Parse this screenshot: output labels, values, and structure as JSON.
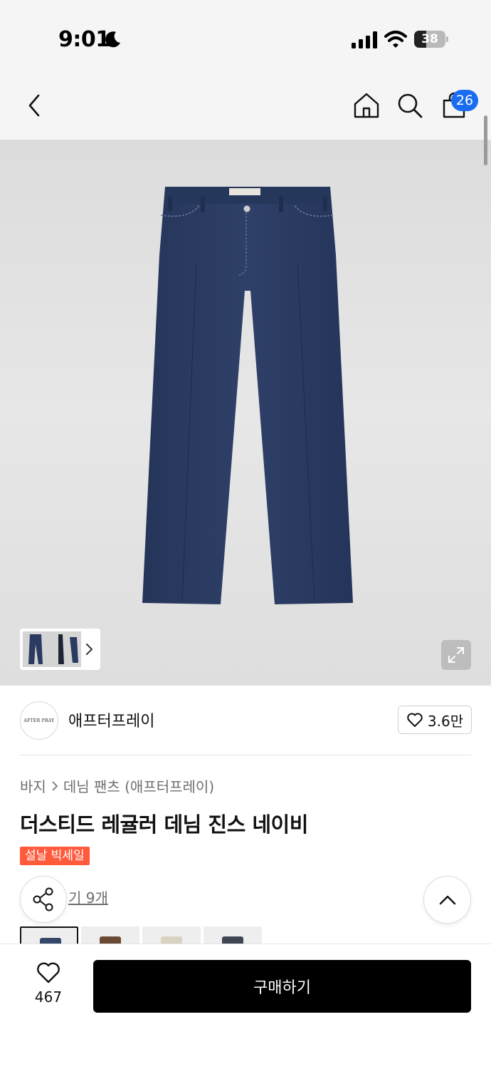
{
  "status_bar": {
    "time": "9:01",
    "battery": "38",
    "battery_level": 0.38,
    "icons": [
      "moon-icon",
      "cellular-signal-icon",
      "wifi-icon",
      "battery-icon"
    ]
  },
  "nav": {
    "icons": [
      "chevron-left-icon",
      "home-icon",
      "search-icon",
      "shopping-bag-icon"
    ],
    "cart_count": "26"
  },
  "gallery": {
    "image_subject": "navy denim jeans",
    "icons": [
      "chevron-right-icon",
      "expand-icon"
    ]
  },
  "brand": {
    "logo_text": "AFTER PRAY",
    "name": "애프터프레이",
    "like_count": "3.6만",
    "like_icon": "heart-outline-icon"
  },
  "product": {
    "breadcrumb": [
      "바지",
      "데님 팬츠 (애프터프레이)"
    ],
    "title": "더스티드 레귤러 데님 진스 네이비",
    "sale_badge": "설날 빅세일",
    "review_link": "기 9개"
  },
  "color_options": {
    "swatch_colors": [
      "#34476a",
      "#6b4a33",
      "#d9d2c2",
      "#3f4652"
    ],
    "selected_index": 0
  },
  "floating": {
    "icons": [
      "share-icon",
      "chevron-up-icon"
    ]
  },
  "bottom_bar": {
    "wish_count": "467",
    "buy_label": "구매하기"
  },
  "colors": {
    "accent_blue": "#1a6cf0",
    "sale_red": "#ff5a3c",
    "buy_black": "#000000",
    "denim_navy": "#2b3a5c"
  }
}
